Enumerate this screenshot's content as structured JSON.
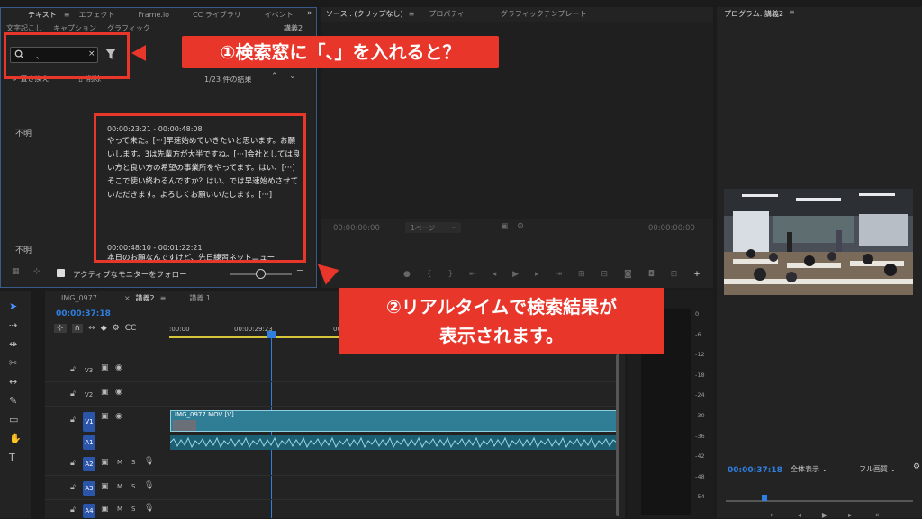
{
  "text_panel": {
    "tabs": [
      "テキスト",
      "エフェクト",
      "Frame.io",
      "CC ライブラリ",
      "イベント"
    ],
    "overflow": "»",
    "subtabs": [
      "文字起こし",
      "キャプション",
      "グラフィック"
    ],
    "right_label": "講義2",
    "search_value": "、",
    "replace_label": "置き換え",
    "delete_label": "削除",
    "result_count": "1/23 件の結果",
    "speaker1": "不明",
    "speaker2": "不明",
    "seg1_time": "00:00:23:21 - 00:00:48:08",
    "seg1_text": "やって来た。[···]早速始めていきたいと思います。お願いします。3は先輩方が大半ですね。[···]会社としては良い方と良い方の希望の事業所をやってます。はい、[···]そこで使い終わるんですか？はい、では早速始めさせていただきます。よろしくお願いいたします。[···]",
    "seg2_time": "00:00:48:10 - 00:01:22:21",
    "seg2_text": "本日のお願なんですけど、先日練習ネットニュー",
    "follow_monitor": "アクティブなモニターをフォロー"
  },
  "source_panel": {
    "tabs": [
      "ソース : (クリップなし)",
      "プロパティ",
      "グラフィックテンプレート"
    ],
    "tc_left": "00:00:00:00",
    "page_select": "1ページ",
    "tc_right": "00:00:00:00"
  },
  "program_panel": {
    "title": "プログラム: 講義2",
    "timecode": "00:00:37:18",
    "fit": "全体表示",
    "quality": "フル画質"
  },
  "timeline": {
    "tabs": [
      "IMG_0977",
      "講義2",
      "講義 1"
    ],
    "close": "×",
    "timecode": "00:00:37:18",
    "ruler": [
      ":00:00",
      "00:00:29:23",
      "00:00:59"
    ],
    "clip_label": "IMG_0977.MOV [V]",
    "tracks": [
      "V3",
      "V2",
      "V1",
      "A1",
      "A2",
      "A3",
      "A4"
    ],
    "mute": "M",
    "solo": "S"
  },
  "meter": {
    "scale": [
      "0",
      "-6",
      "-12",
      "-18",
      "-24",
      "-30",
      "-36",
      "-42",
      "-48",
      "-54"
    ]
  },
  "annotations": {
    "callout1": "①検索窓に「、」を入れると？",
    "callout2_line1": "②リアルタイムで検索結果が",
    "callout2_line2": "表示されます。"
  }
}
